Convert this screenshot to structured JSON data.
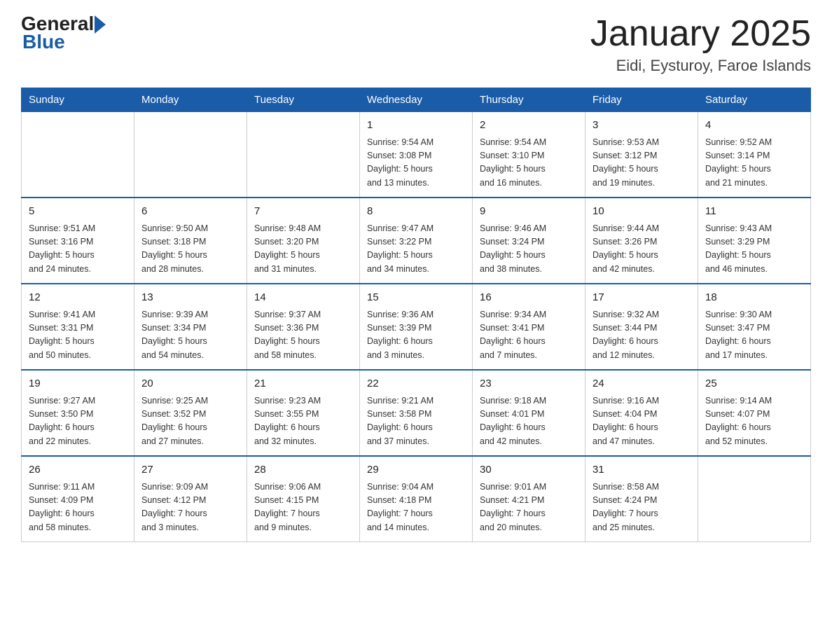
{
  "header": {
    "title": "January 2025",
    "subtitle": "Eidi, Eysturoy, Faroe Islands"
  },
  "logo": {
    "general": "General",
    "blue": "Blue"
  },
  "days": [
    "Sunday",
    "Monday",
    "Tuesday",
    "Wednesday",
    "Thursday",
    "Friday",
    "Saturday"
  ],
  "weeks": [
    [
      {
        "num": "",
        "info": ""
      },
      {
        "num": "",
        "info": ""
      },
      {
        "num": "",
        "info": ""
      },
      {
        "num": "1",
        "info": "Sunrise: 9:54 AM\nSunset: 3:08 PM\nDaylight: 5 hours\nand 13 minutes."
      },
      {
        "num": "2",
        "info": "Sunrise: 9:54 AM\nSunset: 3:10 PM\nDaylight: 5 hours\nand 16 minutes."
      },
      {
        "num": "3",
        "info": "Sunrise: 9:53 AM\nSunset: 3:12 PM\nDaylight: 5 hours\nand 19 minutes."
      },
      {
        "num": "4",
        "info": "Sunrise: 9:52 AM\nSunset: 3:14 PM\nDaylight: 5 hours\nand 21 minutes."
      }
    ],
    [
      {
        "num": "5",
        "info": "Sunrise: 9:51 AM\nSunset: 3:16 PM\nDaylight: 5 hours\nand 24 minutes."
      },
      {
        "num": "6",
        "info": "Sunrise: 9:50 AM\nSunset: 3:18 PM\nDaylight: 5 hours\nand 28 minutes."
      },
      {
        "num": "7",
        "info": "Sunrise: 9:48 AM\nSunset: 3:20 PM\nDaylight: 5 hours\nand 31 minutes."
      },
      {
        "num": "8",
        "info": "Sunrise: 9:47 AM\nSunset: 3:22 PM\nDaylight: 5 hours\nand 34 minutes."
      },
      {
        "num": "9",
        "info": "Sunrise: 9:46 AM\nSunset: 3:24 PM\nDaylight: 5 hours\nand 38 minutes."
      },
      {
        "num": "10",
        "info": "Sunrise: 9:44 AM\nSunset: 3:26 PM\nDaylight: 5 hours\nand 42 minutes."
      },
      {
        "num": "11",
        "info": "Sunrise: 9:43 AM\nSunset: 3:29 PM\nDaylight: 5 hours\nand 46 minutes."
      }
    ],
    [
      {
        "num": "12",
        "info": "Sunrise: 9:41 AM\nSunset: 3:31 PM\nDaylight: 5 hours\nand 50 minutes."
      },
      {
        "num": "13",
        "info": "Sunrise: 9:39 AM\nSunset: 3:34 PM\nDaylight: 5 hours\nand 54 minutes."
      },
      {
        "num": "14",
        "info": "Sunrise: 9:37 AM\nSunset: 3:36 PM\nDaylight: 5 hours\nand 58 minutes."
      },
      {
        "num": "15",
        "info": "Sunrise: 9:36 AM\nSunset: 3:39 PM\nDaylight: 6 hours\nand 3 minutes."
      },
      {
        "num": "16",
        "info": "Sunrise: 9:34 AM\nSunset: 3:41 PM\nDaylight: 6 hours\nand 7 minutes."
      },
      {
        "num": "17",
        "info": "Sunrise: 9:32 AM\nSunset: 3:44 PM\nDaylight: 6 hours\nand 12 minutes."
      },
      {
        "num": "18",
        "info": "Sunrise: 9:30 AM\nSunset: 3:47 PM\nDaylight: 6 hours\nand 17 minutes."
      }
    ],
    [
      {
        "num": "19",
        "info": "Sunrise: 9:27 AM\nSunset: 3:50 PM\nDaylight: 6 hours\nand 22 minutes."
      },
      {
        "num": "20",
        "info": "Sunrise: 9:25 AM\nSunset: 3:52 PM\nDaylight: 6 hours\nand 27 minutes."
      },
      {
        "num": "21",
        "info": "Sunrise: 9:23 AM\nSunset: 3:55 PM\nDaylight: 6 hours\nand 32 minutes."
      },
      {
        "num": "22",
        "info": "Sunrise: 9:21 AM\nSunset: 3:58 PM\nDaylight: 6 hours\nand 37 minutes."
      },
      {
        "num": "23",
        "info": "Sunrise: 9:18 AM\nSunset: 4:01 PM\nDaylight: 6 hours\nand 42 minutes."
      },
      {
        "num": "24",
        "info": "Sunrise: 9:16 AM\nSunset: 4:04 PM\nDaylight: 6 hours\nand 47 minutes."
      },
      {
        "num": "25",
        "info": "Sunrise: 9:14 AM\nSunset: 4:07 PM\nDaylight: 6 hours\nand 52 minutes."
      }
    ],
    [
      {
        "num": "26",
        "info": "Sunrise: 9:11 AM\nSunset: 4:09 PM\nDaylight: 6 hours\nand 58 minutes."
      },
      {
        "num": "27",
        "info": "Sunrise: 9:09 AM\nSunset: 4:12 PM\nDaylight: 7 hours\nand 3 minutes."
      },
      {
        "num": "28",
        "info": "Sunrise: 9:06 AM\nSunset: 4:15 PM\nDaylight: 7 hours\nand 9 minutes."
      },
      {
        "num": "29",
        "info": "Sunrise: 9:04 AM\nSunset: 4:18 PM\nDaylight: 7 hours\nand 14 minutes."
      },
      {
        "num": "30",
        "info": "Sunrise: 9:01 AM\nSunset: 4:21 PM\nDaylight: 7 hours\nand 20 minutes."
      },
      {
        "num": "31",
        "info": "Sunrise: 8:58 AM\nSunset: 4:24 PM\nDaylight: 7 hours\nand 25 minutes."
      },
      {
        "num": "",
        "info": ""
      }
    ]
  ]
}
